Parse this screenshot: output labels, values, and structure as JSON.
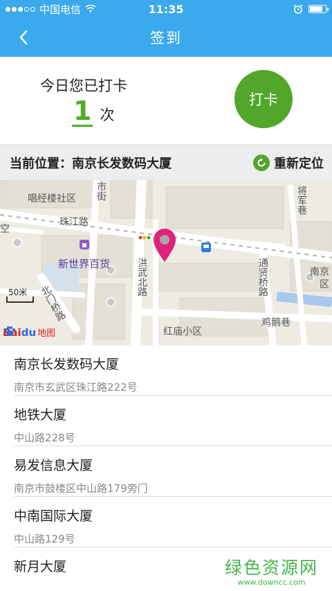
{
  "status_bar": {
    "carrier": "中国电信",
    "time": "11:35",
    "battery_level": 0.85
  },
  "nav": {
    "title": "签到",
    "back_icon": "chevron-left-icon"
  },
  "checkin": {
    "prompt": "今日您已打卡",
    "count": "1",
    "unit": "次",
    "button_label": "打卡",
    "accent_color": "#52a62a"
  },
  "location": {
    "current": "当前位置：南京长发数码大厦",
    "relocate_label": "重新定位"
  },
  "map": {
    "labels": {
      "changxin_lou": "唱经楼社区",
      "zhujiang_lu": "珠江路",
      "xinshijie": "新世界百货",
      "hongwu_beilu": "洪武北路",
      "tongxian_qiaolu": "通贤桥路",
      "jizhan_xiang": "鸡鹅巷",
      "hongmiao": "红庙小区",
      "beimen_qiao": "北门桥路",
      "jiangjun_xiang": "将军巷",
      "shijie_top": "市街",
      "nanjing_right": "南京",
      "qu_right": "区",
      "kong_left": "空"
    },
    "scale": "50米",
    "logo": {
      "bai": "Bai",
      "du": "du",
      "ditu": "地图"
    }
  },
  "places": [
    {
      "name": "南京长发数码大厦",
      "address": "南京市玄武区珠江路222号"
    },
    {
      "name": "地铁大厦",
      "address": "中山路228号"
    },
    {
      "name": "易发信息大厦",
      "address": "南京市鼓楼区中山路179旁门"
    },
    {
      "name": "中南国际大厦",
      "address": "中山路129号"
    },
    {
      "name": "新月大厦",
      "address": ""
    }
  ],
  "watermark": {
    "main": "绿色资源网",
    "url": "www.downcc.com"
  }
}
